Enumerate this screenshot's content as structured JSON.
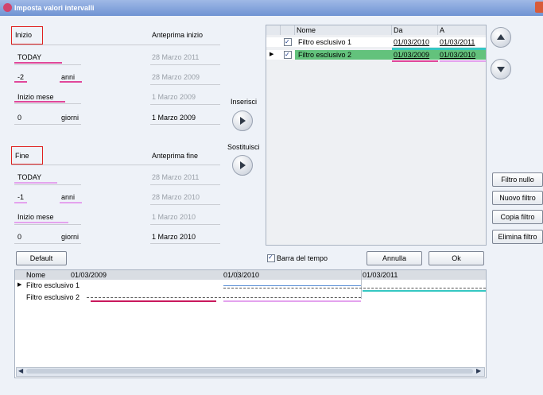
{
  "title": "Imposta valori intervalli",
  "start": {
    "header": "Inizio",
    "preview_header": "Anteprima inizio",
    "rows": [
      {
        "value": "TODAY",
        "unit": "",
        "preview": "28 Marzo 2011"
      },
      {
        "value": "-2",
        "unit": "anni",
        "preview": "28 Marzo 2009"
      },
      {
        "value": "Inizio mese",
        "unit": "",
        "preview": "1 Marzo 2009"
      },
      {
        "value": "0",
        "unit": "giorni",
        "preview": "1 Marzo 2009"
      }
    ]
  },
  "end": {
    "header": "Fine",
    "preview_header": "Anteprima fine",
    "rows": [
      {
        "value": "TODAY",
        "unit": "",
        "preview": "28 Marzo 2011"
      },
      {
        "value": "-1",
        "unit": "anni",
        "preview": "28 Marzo 2010"
      },
      {
        "value": "Inizio mese",
        "unit": "",
        "preview": "1 Marzo 2010"
      },
      {
        "value": "0",
        "unit": "giorni",
        "preview": "1 Marzo 2010"
      }
    ]
  },
  "buttons": {
    "insert": "Inserisci",
    "replace": "Sostituisci",
    "default": "Default",
    "cancel": "Annulla",
    "ok": "Ok",
    "filtro_nullo": "Filtro nullo",
    "nuovo_filtro": "Nuovo filtro",
    "copia_filtro": "Copia filtro",
    "elimina_filtro": "Elimina filtro"
  },
  "filters": {
    "columns": [
      "Nome",
      "Da",
      "A"
    ],
    "rows": [
      {
        "name": "Filtro esclusivo 1",
        "from": "01/03/2010",
        "to": "01/03/2011",
        "checked": true,
        "selected": false
      },
      {
        "name": "Filtro esclusivo 2",
        "from": "01/03/2009",
        "to": "01/03/2010",
        "checked": true,
        "selected": true
      }
    ]
  },
  "timebar": {
    "label": "Barra del tempo",
    "checked": true,
    "name_header": "Nome",
    "dates": [
      "01/03/2009",
      "01/03/2010",
      "01/03/2011"
    ],
    "rows": [
      "Filtro esclusivo 1",
      "Filtro esclusivo 2"
    ]
  },
  "colors": {
    "accent_pink": "#e0479a",
    "accent_lilac": "#e4a3ee",
    "selected_row": "#63c27c",
    "bar_blue": "#5b8fd6",
    "bar_teal": "#35c7c2"
  }
}
